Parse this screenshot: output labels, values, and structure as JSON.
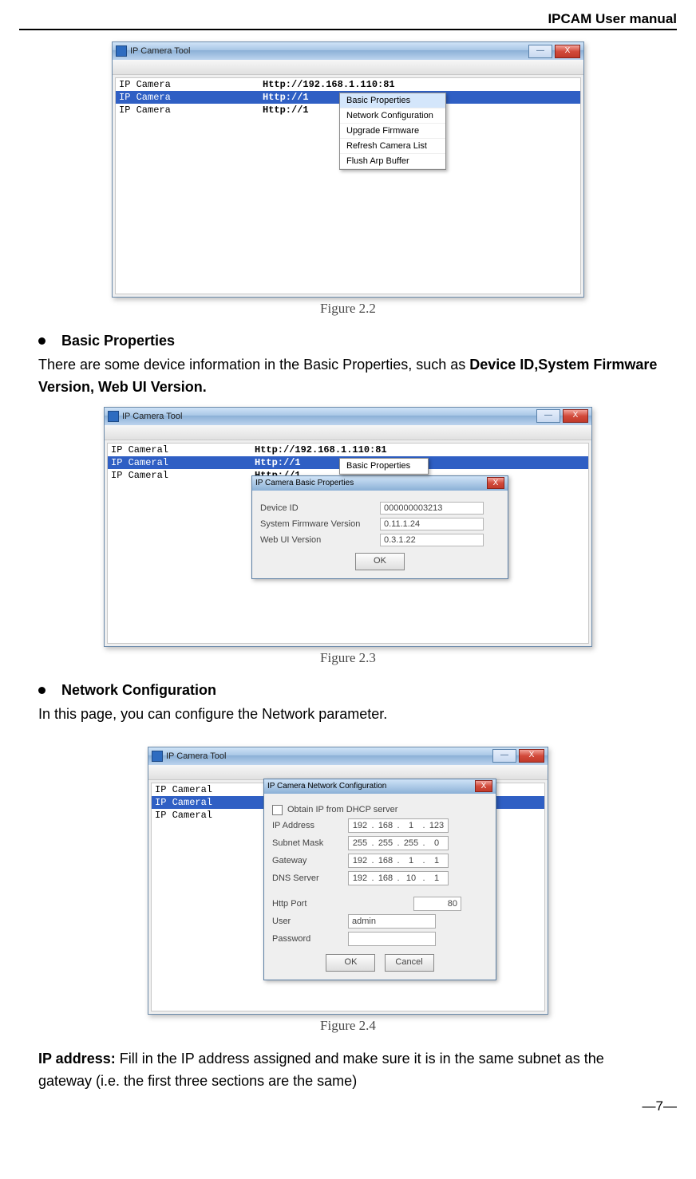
{
  "header": {
    "title": "IPCAM User manual"
  },
  "page_number": "—7—",
  "bullet1_title": "Basic Properties",
  "bullet1_para_pre": "There are some device information in the Basic Properties, such as ",
  "bullet1_para_bold": "Device ID,System Firmware Version, Web UI Version.",
  "bullet2_title": "Network Configuration",
  "bullet2_para": "In this page, you can configure the Network parameter.",
  "ip_para_bold": "IP address:",
  "ip_para_rest": " Fill in the IP address assigned and make sure it is in the same subnet as the gateway (i.e. the first three sections are the same)",
  "captions": {
    "fig22": "Figure 2.2",
    "fig23": "Figure 2.3",
    "fig24": "Figure 2.4"
  },
  "fig22": {
    "title": "IP Camera Tool",
    "rows": [
      {
        "name": "IP Camera",
        "url": "Http://192.168.1.110:81"
      },
      {
        "name": "IP Camera",
        "url": "Http://1"
      },
      {
        "name": "IP Camera",
        "url": "Http://1"
      }
    ],
    "ctx": [
      "Basic Properties",
      "Network Configuration",
      "Upgrade Firmware",
      "Refresh Camera List",
      "Flush Arp Buffer"
    ]
  },
  "fig23": {
    "title": "IP Camera Tool",
    "rows": [
      {
        "name": "IP Cameral",
        "url": "Http://192.168.1.110:81"
      },
      {
        "name": "IP Cameral",
        "url": "Http://1"
      },
      {
        "name": "IP Cameral",
        "url": "Http://1"
      }
    ],
    "ctx_item": "Basic Properties",
    "dlg_title": "IP Camera  Basic Properties",
    "props": {
      "device_id_label": "Device ID",
      "device_id_value": "000000003213",
      "fw_label": "System Firmware Version",
      "fw_value": "0.11.1.24",
      "web_label": "Web UI Version",
      "web_value": "0.3.1.22"
    },
    "ok": "OK"
  },
  "fig24": {
    "title": "IP Camera Tool",
    "rows": [
      {
        "name": "IP Cameral"
      },
      {
        "name": "IP Cameral"
      },
      {
        "name": "IP Cameral"
      }
    ],
    "dlg_title": "IP Camera   Network Configuration",
    "dhcp_label": "Obtain IP from DHCP server",
    "fields": {
      "ip_label": "IP Address",
      "ip_value": [
        "192",
        "168",
        "1",
        "123"
      ],
      "mask_label": "Subnet Mask",
      "mask_value": [
        "255",
        "255",
        "255",
        "0"
      ],
      "gw_label": "Gateway",
      "gw_value": [
        "192",
        "168",
        "1",
        "1"
      ],
      "dns_label": "DNS Server",
      "dns_value": [
        "192",
        "168",
        "10",
        "1"
      ],
      "port_label": "Http Port",
      "port_value": "80",
      "user_label": "User",
      "user_value": "admin",
      "pass_label": "Password",
      "pass_value": ""
    },
    "ok": "OK",
    "cancel": "Cancel"
  }
}
